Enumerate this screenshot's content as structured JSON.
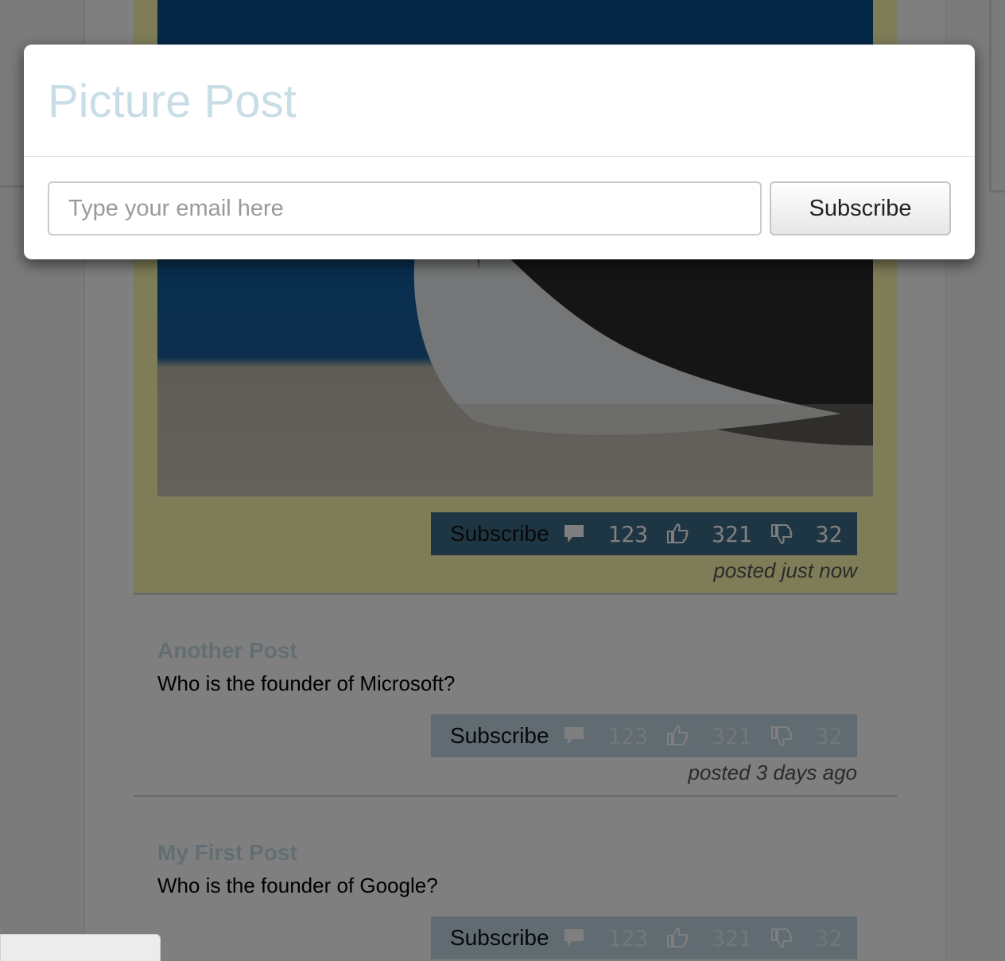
{
  "modal": {
    "title": "Picture Post",
    "email_placeholder": "Type your email here",
    "subscribe_label": "Subscribe"
  },
  "posts": [
    {
      "title": "",
      "body": "",
      "subscribe_label": "Subscribe",
      "comments": "123",
      "likes": "321",
      "dislikes": "32",
      "posted": "posted just now"
    },
    {
      "title": "Another Post",
      "body": "Who is the founder of Microsoft?",
      "subscribe_label": "Subscribe",
      "comments": "123",
      "likes": "321",
      "dislikes": "32",
      "posted": "posted 3 days ago"
    },
    {
      "title": "My First Post",
      "body": "Who is the founder of Google?",
      "subscribe_label": "Subscribe",
      "comments": "123",
      "likes": "321",
      "dislikes": "32"
    }
  ],
  "icons": {
    "comment": "comment-icon",
    "like": "thumbs-up-icon",
    "dislike": "thumbs-down-icon"
  },
  "colors": {
    "featured_background": "#fdfbb0",
    "title_color": "#c8dde6",
    "action_bar": "#c1d9e2",
    "featured_action_bar": "#3c6b86"
  }
}
